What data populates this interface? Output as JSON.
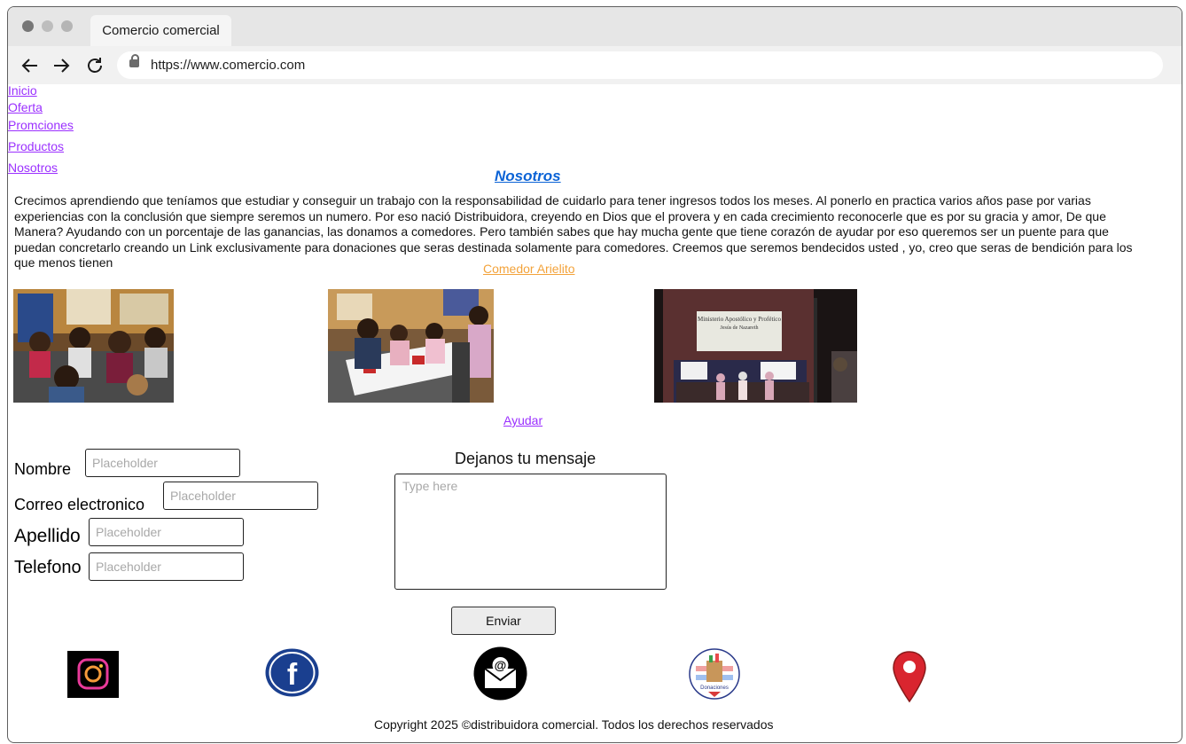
{
  "browser": {
    "tab_title": "Comercio comercial",
    "url": "https://www.comercio.com"
  },
  "menu": [
    "Inicio",
    "Oferta",
    "Promciones",
    "Productos",
    "Nosotros"
  ],
  "section": {
    "title": "Nosotros",
    "paragraph": "Crecimos aprendiendo que teníamos que estudiar y conseguir un trabajo con la responsabilidad de cuidarlo para tener ingresos todos los meses. Al ponerlo en practica varios años pase por varias experiencias con la conclusión que siempre seremos un numero. Por eso nació Distribuidora, creyendo en Dios que el provera y en cada crecimiento reconocerle que es por su gracia y amor, De que Manera? Ayudando con un porcentaje de las ganancias, las donamos a comedores. Pero también sabes que hay mucha gente que tiene corazón de ayudar por eso queremos ser un puente para que puedan concretarlo creando un Link exclusivamente para donaciones que seras destinada solamente para comedores. Creemos que seremos bendecidos usted , yo, creo que seras de bendición para los que menos tienen",
    "comedor_link": "Comedor Arielito",
    "help_link": "Ayudar"
  },
  "photos": [
    "children-eating-photo",
    "children-drawing-photo",
    "church-building-night-photo"
  ],
  "sign_text": "Ministerio Apostólico y Profético Jesús de Nazareth",
  "form": {
    "nombre_label": "Nombre",
    "correo_label": "Correo electronico",
    "apellido_label": "Apellido",
    "telefono_label": "Telefono",
    "placeholder": "Placeholder",
    "message_title": "Dejanos tu mensaje",
    "message_placeholder": "Type here",
    "send_label": "Enviar"
  },
  "social": {
    "icons": [
      "instagram-icon",
      "facebook-icon",
      "email-icon",
      "donaciones-icon",
      "location-icon"
    ],
    "donaciones_text": "Donaciones"
  },
  "footer": {
    "copyright": "Copyright 2025 ©distribuidora comercial. Todos los derechos reservados"
  },
  "colors": {
    "link": "#9b30ff",
    "heading": "#0b63d6",
    "orange_link": "#f3a33b",
    "facebook": "#1a3f8f",
    "location": "#d9252f"
  }
}
